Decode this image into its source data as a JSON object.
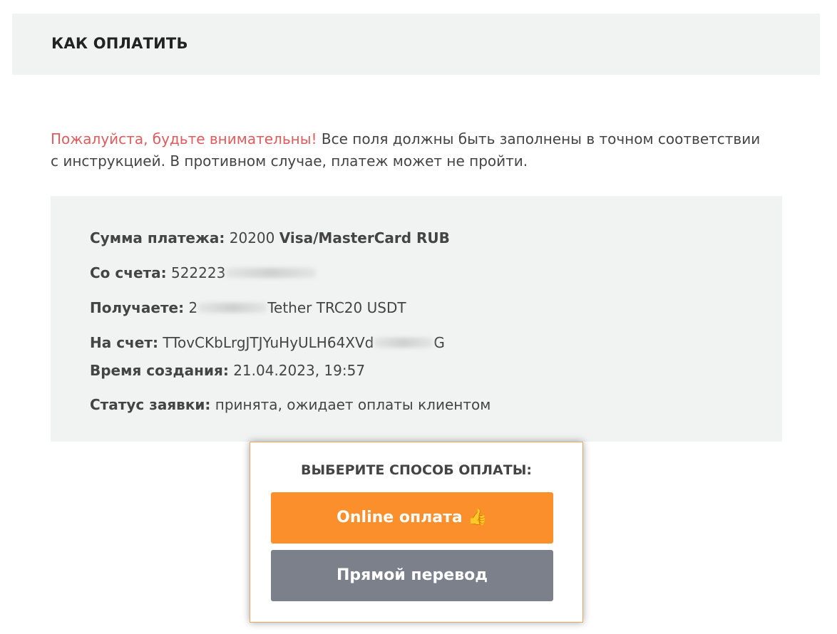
{
  "header": {
    "title": "КАК ОПЛАТИТЬ"
  },
  "warning": {
    "lead": "Пожалуйста, будьте внимательны!",
    "text": " Все поля должны быть заполнены в точном соответствии с инструкцией. В противном случае, платеж может не пройти."
  },
  "details": {
    "amount_label": "Сумма платежа:",
    "amount_value": "20200",
    "amount_currency": "Visa/MasterCard RUB",
    "from_label": "Со счета:",
    "from_value": "522223",
    "receive_label": "Получаете:",
    "receive_prefix": "2",
    "receive_value": "Tether TRC20 USDT",
    "to_label": "На счет:",
    "to_value": "TTovCKbLrgJTJYuHyULH64XVd",
    "to_suffix": "G",
    "created_label": "Время создания:",
    "created_value": "21.04.2023, 19:57",
    "status_label": "Статус заявки:",
    "status_value": "принята, ожидает оплаты клиентом"
  },
  "payment": {
    "title": "ВЫБЕРИТЕ СПОСОБ ОПЛАТЫ:",
    "online_label": "Online оплата",
    "online_icon": "thumbs-up-icon",
    "direct_label": "Прямой перевод"
  },
  "colors": {
    "warning_red": "#e05b5b",
    "online_button": "#fb8f2c",
    "direct_button": "#7b808a",
    "panel_bg": "#f1f3f2"
  }
}
